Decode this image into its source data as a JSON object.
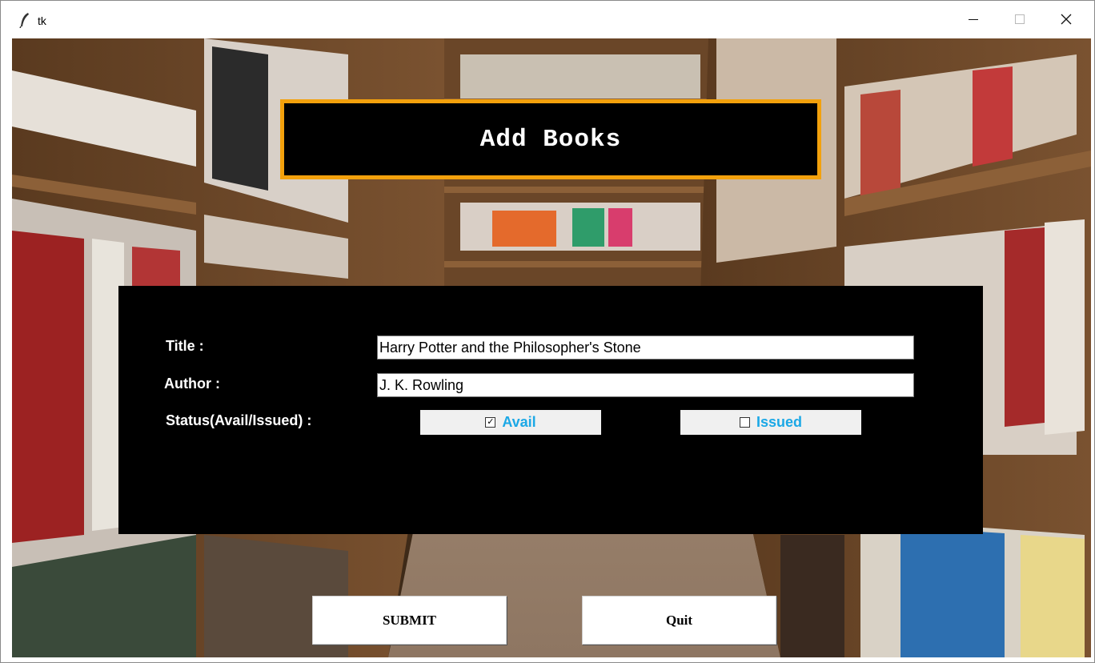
{
  "window": {
    "title": "tk",
    "minimize_icon": "minimize-icon",
    "maximize_icon": "maximize-icon",
    "close_icon": "close-icon",
    "app_icon": "feather-icon"
  },
  "heading": {
    "text": "Add Books",
    "border_color": "#f3a10c"
  },
  "form": {
    "title_label": "Title :",
    "title_value": "Harry Potter and the Philosopher's Stone",
    "author_label": "Author :",
    "author_value": "J. K. Rowling",
    "status_label": "Status(Avail/Issued) :",
    "avail": {
      "label": "Avail",
      "checked": true
    },
    "issued": {
      "label": "Issued",
      "checked": false
    },
    "checkbox_text_color": "#1ba8e6"
  },
  "buttons": {
    "submit": "SUBMIT",
    "quit": "Quit"
  }
}
